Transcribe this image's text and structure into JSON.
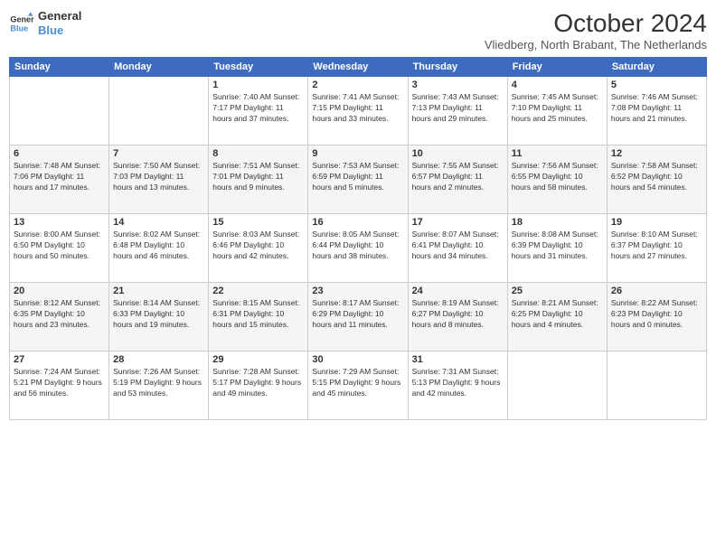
{
  "logo": {
    "line1": "General",
    "line2": "Blue"
  },
  "title": "October 2024",
  "subtitle": "Vliedberg, North Brabant, The Netherlands",
  "days_header": [
    "Sunday",
    "Monday",
    "Tuesday",
    "Wednesday",
    "Thursday",
    "Friday",
    "Saturday"
  ],
  "weeks": [
    [
      {
        "day": "",
        "info": ""
      },
      {
        "day": "",
        "info": ""
      },
      {
        "day": "1",
        "info": "Sunrise: 7:40 AM\nSunset: 7:17 PM\nDaylight: 11 hours and 37 minutes."
      },
      {
        "day": "2",
        "info": "Sunrise: 7:41 AM\nSunset: 7:15 PM\nDaylight: 11 hours and 33 minutes."
      },
      {
        "day": "3",
        "info": "Sunrise: 7:43 AM\nSunset: 7:13 PM\nDaylight: 11 hours and 29 minutes."
      },
      {
        "day": "4",
        "info": "Sunrise: 7:45 AM\nSunset: 7:10 PM\nDaylight: 11 hours and 25 minutes."
      },
      {
        "day": "5",
        "info": "Sunrise: 7:46 AM\nSunset: 7:08 PM\nDaylight: 11 hours and 21 minutes."
      }
    ],
    [
      {
        "day": "6",
        "info": "Sunrise: 7:48 AM\nSunset: 7:06 PM\nDaylight: 11 hours and 17 minutes."
      },
      {
        "day": "7",
        "info": "Sunrise: 7:50 AM\nSunset: 7:03 PM\nDaylight: 11 hours and 13 minutes."
      },
      {
        "day": "8",
        "info": "Sunrise: 7:51 AM\nSunset: 7:01 PM\nDaylight: 11 hours and 9 minutes."
      },
      {
        "day": "9",
        "info": "Sunrise: 7:53 AM\nSunset: 6:59 PM\nDaylight: 11 hours and 5 minutes."
      },
      {
        "day": "10",
        "info": "Sunrise: 7:55 AM\nSunset: 6:57 PM\nDaylight: 11 hours and 2 minutes."
      },
      {
        "day": "11",
        "info": "Sunrise: 7:56 AM\nSunset: 6:55 PM\nDaylight: 10 hours and 58 minutes."
      },
      {
        "day": "12",
        "info": "Sunrise: 7:58 AM\nSunset: 6:52 PM\nDaylight: 10 hours and 54 minutes."
      }
    ],
    [
      {
        "day": "13",
        "info": "Sunrise: 8:00 AM\nSunset: 6:50 PM\nDaylight: 10 hours and 50 minutes."
      },
      {
        "day": "14",
        "info": "Sunrise: 8:02 AM\nSunset: 6:48 PM\nDaylight: 10 hours and 46 minutes."
      },
      {
        "day": "15",
        "info": "Sunrise: 8:03 AM\nSunset: 6:46 PM\nDaylight: 10 hours and 42 minutes."
      },
      {
        "day": "16",
        "info": "Sunrise: 8:05 AM\nSunset: 6:44 PM\nDaylight: 10 hours and 38 minutes."
      },
      {
        "day": "17",
        "info": "Sunrise: 8:07 AM\nSunset: 6:41 PM\nDaylight: 10 hours and 34 minutes."
      },
      {
        "day": "18",
        "info": "Sunrise: 8:08 AM\nSunset: 6:39 PM\nDaylight: 10 hours and 31 minutes."
      },
      {
        "day": "19",
        "info": "Sunrise: 8:10 AM\nSunset: 6:37 PM\nDaylight: 10 hours and 27 minutes."
      }
    ],
    [
      {
        "day": "20",
        "info": "Sunrise: 8:12 AM\nSunset: 6:35 PM\nDaylight: 10 hours and 23 minutes."
      },
      {
        "day": "21",
        "info": "Sunrise: 8:14 AM\nSunset: 6:33 PM\nDaylight: 10 hours and 19 minutes."
      },
      {
        "day": "22",
        "info": "Sunrise: 8:15 AM\nSunset: 6:31 PM\nDaylight: 10 hours and 15 minutes."
      },
      {
        "day": "23",
        "info": "Sunrise: 8:17 AM\nSunset: 6:29 PM\nDaylight: 10 hours and 11 minutes."
      },
      {
        "day": "24",
        "info": "Sunrise: 8:19 AM\nSunset: 6:27 PM\nDaylight: 10 hours and 8 minutes."
      },
      {
        "day": "25",
        "info": "Sunrise: 8:21 AM\nSunset: 6:25 PM\nDaylight: 10 hours and 4 minutes."
      },
      {
        "day": "26",
        "info": "Sunrise: 8:22 AM\nSunset: 6:23 PM\nDaylight: 10 hours and 0 minutes."
      }
    ],
    [
      {
        "day": "27",
        "info": "Sunrise: 7:24 AM\nSunset: 5:21 PM\nDaylight: 9 hours and 56 minutes."
      },
      {
        "day": "28",
        "info": "Sunrise: 7:26 AM\nSunset: 5:19 PM\nDaylight: 9 hours and 53 minutes."
      },
      {
        "day": "29",
        "info": "Sunrise: 7:28 AM\nSunset: 5:17 PM\nDaylight: 9 hours and 49 minutes."
      },
      {
        "day": "30",
        "info": "Sunrise: 7:29 AM\nSunset: 5:15 PM\nDaylight: 9 hours and 45 minutes."
      },
      {
        "day": "31",
        "info": "Sunrise: 7:31 AM\nSunset: 5:13 PM\nDaylight: 9 hours and 42 minutes."
      },
      {
        "day": "",
        "info": ""
      },
      {
        "day": "",
        "info": ""
      }
    ]
  ]
}
